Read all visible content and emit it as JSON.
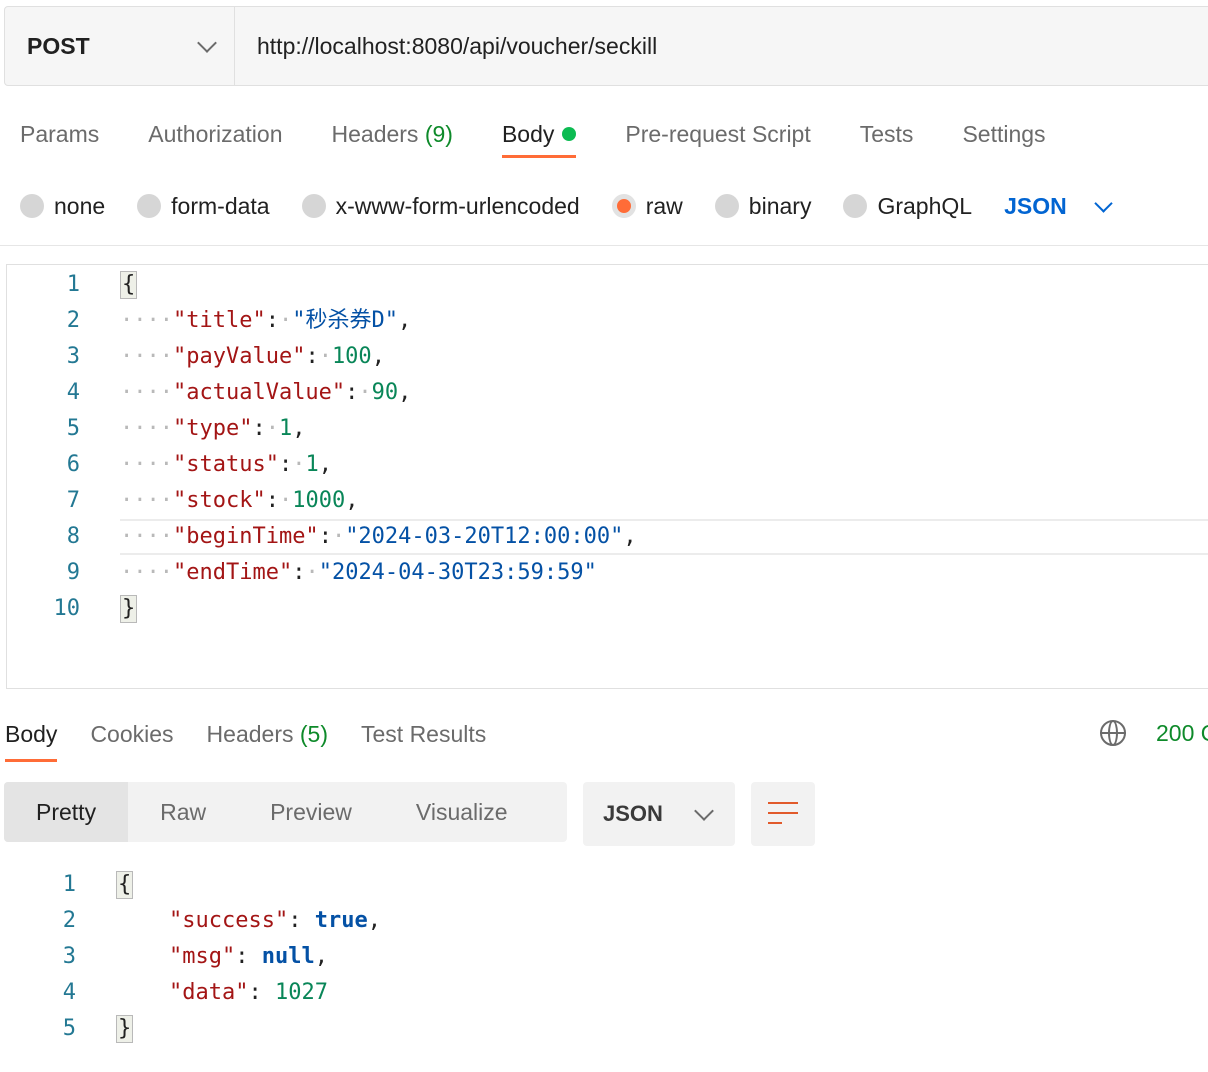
{
  "request": {
    "method": "POST",
    "url": "http://localhost:8080/api/voucher/seckill"
  },
  "request_tabs": [
    {
      "label": "Params"
    },
    {
      "label": "Authorization"
    },
    {
      "label": "Headers",
      "count": "(9)"
    },
    {
      "label": "Body",
      "active": true
    },
    {
      "label": "Pre-request Script"
    },
    {
      "label": "Tests"
    },
    {
      "label": "Settings"
    }
  ],
  "body_types": [
    {
      "label": "none"
    },
    {
      "label": "form-data"
    },
    {
      "label": "x-www-form-urlencoded"
    },
    {
      "label": "raw",
      "selected": true
    },
    {
      "label": "binary"
    },
    {
      "label": "GraphQL"
    }
  ],
  "body_format": "JSON",
  "request_body": {
    "line_numbers": [
      "1",
      "2",
      "3",
      "4",
      "5",
      "6",
      "7",
      "8",
      "9",
      "10"
    ],
    "open_brace": "{",
    "close_brace": "}",
    "fields": [
      {
        "key": "\"title\"",
        "value": "\"秒杀券D\"",
        "sep": ","
      },
      {
        "key": "\"payValue\"",
        "value": "100",
        "sep": ","
      },
      {
        "key": "\"actualValue\"",
        "value": "90",
        "sep": ","
      },
      {
        "key": "\"type\"",
        "value": "1",
        "sep": ","
      },
      {
        "key": "\"status\"",
        "value": "1",
        "sep": ","
      },
      {
        "key": "\"stock\"",
        "value": "1000",
        "sep": ","
      },
      {
        "key": "\"beginTime\"",
        "value": "\"2024-03-20T12:00:00\"",
        "sep": ","
      },
      {
        "key": "\"endTime\"",
        "value": "\"2024-04-30T23:59:59\"",
        "sep": ""
      }
    ]
  },
  "response_tabs": [
    {
      "label": "Body",
      "active": true
    },
    {
      "label": "Cookies"
    },
    {
      "label": "Headers",
      "count": "(5)"
    },
    {
      "label": "Test Results"
    }
  ],
  "response_status": "200 O",
  "response_views": [
    {
      "label": "Pretty",
      "active": true
    },
    {
      "label": "Raw"
    },
    {
      "label": "Preview"
    },
    {
      "label": "Visualize"
    }
  ],
  "response_format": "JSON",
  "response_body": {
    "line_numbers": [
      "1",
      "2",
      "3",
      "4",
      "5"
    ],
    "open_brace": "{",
    "close_brace": "}",
    "fields": [
      {
        "key": "\"success\"",
        "value": "true",
        "sep": ","
      },
      {
        "key": "\"msg\"",
        "value": "null",
        "sep": ","
      },
      {
        "key": "\"data\"",
        "value": "1027",
        "sep": ""
      }
    ]
  },
  "colors": {
    "accent": "#ff6c37",
    "count_green": "#0e8a2a",
    "format_blue": "#0265d2",
    "json_key": "#a31515",
    "json_string": "#0451a5",
    "json_number": "#098658"
  }
}
